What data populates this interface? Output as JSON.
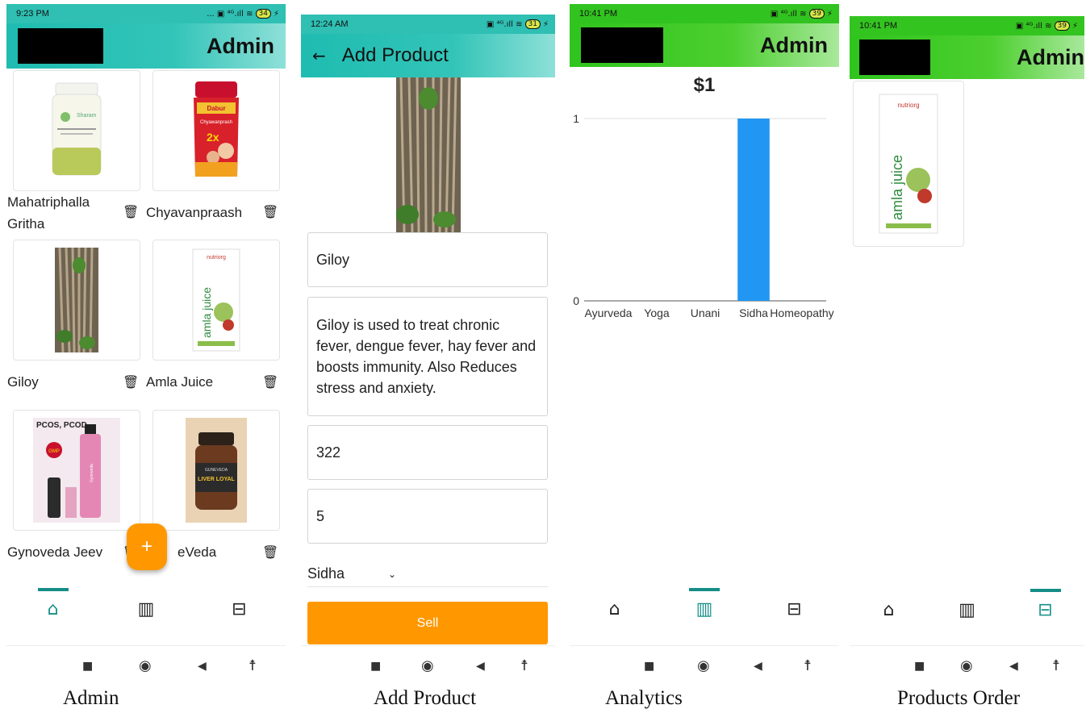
{
  "screens": {
    "admin": {
      "status_time": "9:23 PM",
      "status_icons": "... ▣ ⁴ᴳ.ıll ≋",
      "battery": "34",
      "title": "Admin",
      "products": [
        {
          "name_line1": "Mahatriphalla",
          "name_line2": "Gritha",
          "image": "triphala-ghrita-jar"
        },
        {
          "name_line1": "Chyavanpraash",
          "name_line2": "",
          "image": "chyawanprash-jar"
        },
        {
          "name_line1": "Giloy",
          "name_line2": "",
          "image": "giloy-stems"
        },
        {
          "name_line1": "Amla Juice",
          "name_line2": "",
          "image": "amla-juice-carton"
        },
        {
          "name_line1": "Gynoveda Jeev",
          "name_line2": "",
          "image": "gynoveda-bottles"
        },
        {
          "name_line1": "eVeda",
          "name_line2": "",
          "image": "liver-loyal-bottle"
        }
      ],
      "image_texts": {
        "triphala": "Sharam",
        "chyawan_brand": "Dabur",
        "chyawan_label": "Chyawanprash",
        "chyawan_2x": "2x",
        "amla_brand": "nutriorg",
        "amla_word": "amla juice",
        "pcos": "PCOS, PCOD",
        "gmp": "GMP",
        "gyno_label": "Gynoveda",
        "liver_brand": "GUNEVEDA",
        "liver_label": "LIVER LOYAL"
      },
      "fab": "+",
      "caption": "Admin"
    },
    "add_product": {
      "status_time": "12:24 AM",
      "status_icons": "▣ ⁴ᴳ.ıll ≋",
      "battery": "31",
      "back": "←",
      "title": "Add Product",
      "name_value": "Giloy",
      "description_value": "Giloy is used to treat chronic fever, dengue fever, hay fever and boosts immunity. Also Reduces stress and anxiety.",
      "price_value": "322",
      "quantity_value": "5",
      "category_selected": "Sidha",
      "sell_label": "Sell",
      "caption": "Add Product"
    },
    "analytics": {
      "status_time": "10:41 PM",
      "status_icons": "▣ ⁴ᴳ.ıll ≋",
      "battery": "39",
      "title": "Admin",
      "caption": "Analytics"
    },
    "orders": {
      "status_time": "10:41 PM",
      "status_icons": "▣ ⁴ᴳ.ıll ≋",
      "battery": "39",
      "title": "Admin",
      "image_texts": {
        "amla_brand": "nutriorg",
        "amla_word": "amla juice"
      },
      "caption": "Products Order"
    }
  },
  "chart_data": {
    "type": "bar",
    "title": "$1",
    "categories": [
      "Ayurveda",
      "Yoga",
      "Unani",
      "Sidha",
      "Homeopathy"
    ],
    "values": [
      0,
      0,
      0,
      1,
      0
    ],
    "yticks": [
      0,
      1
    ],
    "ylim": [
      0,
      1
    ],
    "grid": true,
    "bar_color": "#2196f3"
  },
  "nav_icons": [
    "home-icon",
    "analytics-icon",
    "orders-icon"
  ],
  "system_nav": [
    "■",
    "◉",
    "◀",
    "☨"
  ],
  "colors": {
    "teal": "#1fbcb1",
    "green": "#2fc41d",
    "accent": "#ff9800",
    "nav_active": "#158d88"
  }
}
